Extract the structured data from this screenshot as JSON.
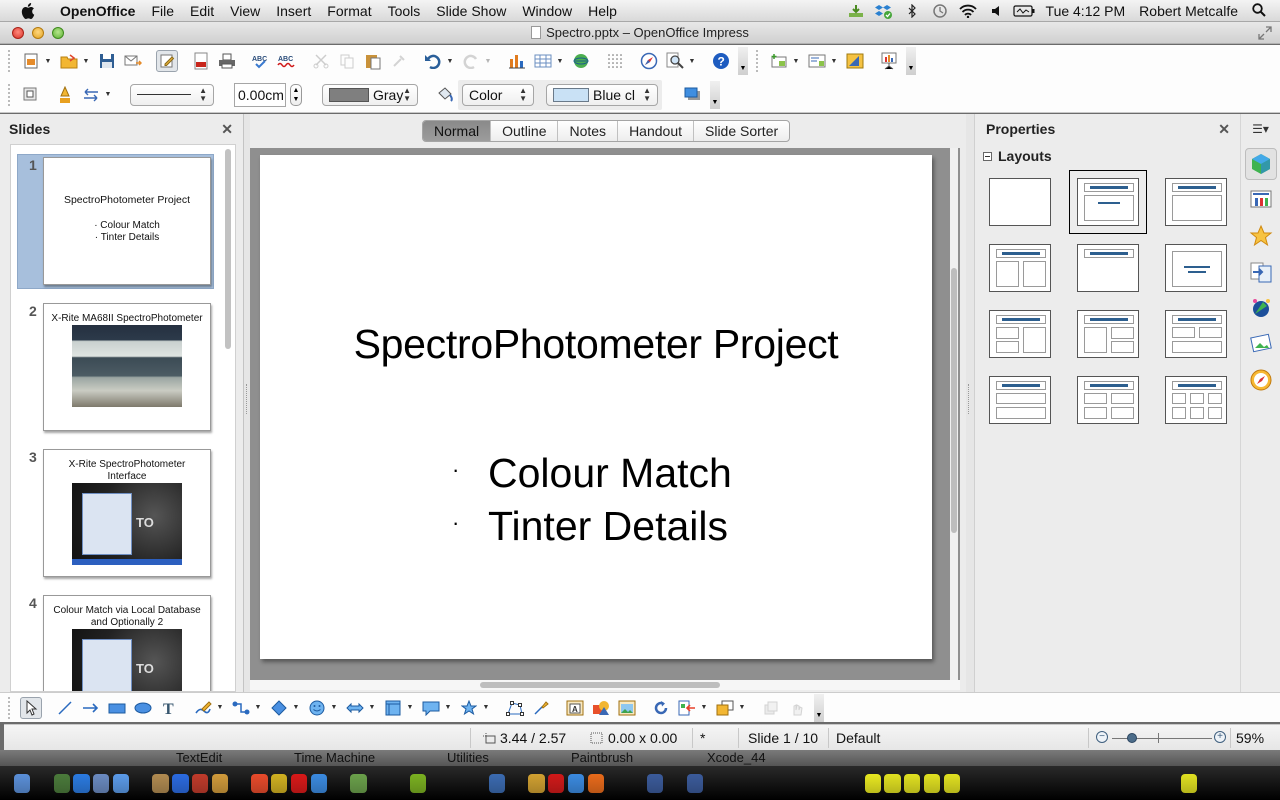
{
  "menubar": {
    "app_name": "OpenOffice",
    "menus": [
      "File",
      "Edit",
      "View",
      "Insert",
      "Format",
      "Tools",
      "Slide Show",
      "Window",
      "Help"
    ],
    "status_icons": [
      "download-icon",
      "dropbox-icon",
      "bluetooth-icon",
      "time-machine-icon",
      "wifi-icon",
      "volume-icon",
      "battery-icon"
    ],
    "clock": "Tue 4:12 PM",
    "user": "Robert Metcalfe"
  },
  "window": {
    "title": "Spectro.pptx – OpenOffice Impress"
  },
  "toolbar2": {
    "line_width": "0.00cm",
    "line_color": "Gray",
    "line_color_hex": "#7f7f7f",
    "area_style": "Color",
    "area_color": "Blue cl",
    "area_color_hex": "#c9e1f5"
  },
  "slides_panel": {
    "title": "Slides",
    "slides": [
      {
        "number": "1",
        "title": "SpectroPhotometer  Project",
        "bullets": [
          "· Colour Match",
          "· Tinter Details"
        ],
        "selected": true
      },
      {
        "number": "2",
        "title": "X-Rite MA68II SpectroPhotometer",
        "image": "device-photo"
      },
      {
        "number": "3",
        "title": "X-Rite SpectroPhotometer Interface",
        "image": "screenshot",
        "image_text": "TO"
      },
      {
        "number": "4",
        "title": "Colour Match via Local Database and Optionally 2",
        "image": "screenshot",
        "image_text": "TO"
      }
    ]
  },
  "view_tabs": [
    {
      "label": "Normal",
      "active": true
    },
    {
      "label": "Outline",
      "active": false
    },
    {
      "label": "Notes",
      "active": false
    },
    {
      "label": "Handout",
      "active": false
    },
    {
      "label": "Slide Sorter",
      "active": false
    }
  ],
  "current_slide": {
    "title": "SpectroPhotometer Project",
    "bullet_char": "·",
    "bullets": [
      "Colour Match",
      "Tinter Details"
    ]
  },
  "properties_panel": {
    "title": "Properties",
    "section": "Layouts",
    "selected_layout_index": 1,
    "layouts": [
      "Blank Slide",
      "Title, Content",
      "Title and 2 Content",
      "Title, 2 Content",
      "Title Only",
      "Centered Text",
      "Title, 2 Content and Content",
      "Title, Content and 2 Content",
      "Title, 2 Content over Content",
      "Title, Content over Content",
      "Title, 4 Content",
      "Title, 6 Content"
    ],
    "deck_icons": [
      "properties-icon",
      "master-pages-icon",
      "custom-animation-icon",
      "slide-transition-icon",
      "styles-icon",
      "gallery-icon",
      "navigator-icon"
    ]
  },
  "statusbar": {
    "position": "3.44 / 2.57",
    "size": "0.00 x 0.00",
    "modified": "*",
    "slide": "Slide 1 / 10",
    "master": "Default",
    "zoom": "59%",
    "zoom_slider_fraction": 0.2
  },
  "dock": {
    "labels": [
      "TextEdit",
      "Time Machine",
      "Utilities",
      "Paintbrush",
      "Xcode_44"
    ]
  }
}
